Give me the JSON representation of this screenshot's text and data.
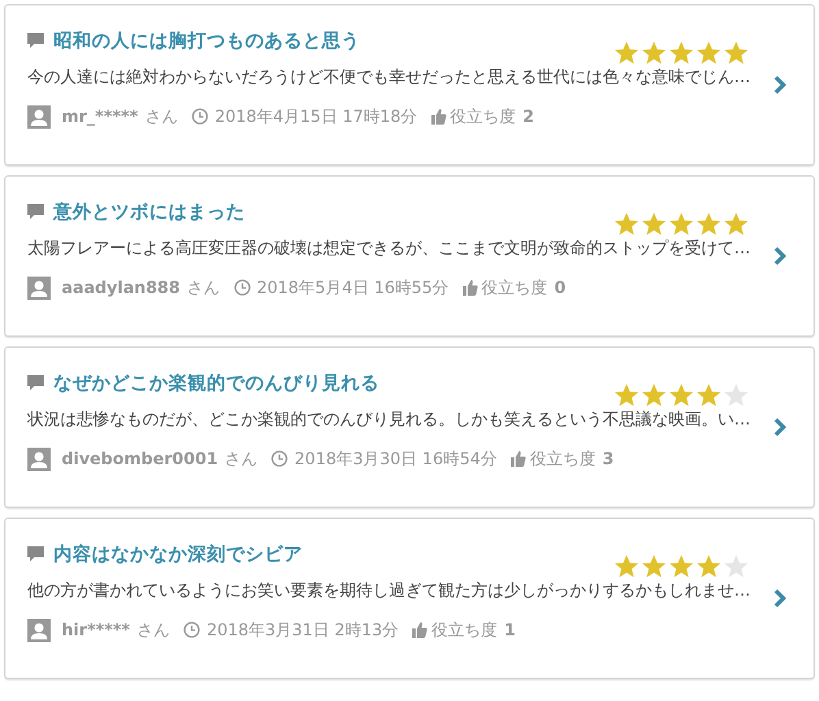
{
  "reviews": [
    {
      "title": "昭和の人には胸打つものあると思う",
      "stars": 5,
      "excerpt": "今の人達には絶対わからないだろうけど不便でも幸せだったと思える世代には色々な意味でじん…",
      "user": "mr_*****",
      "honorific": "さん",
      "date": "2018年4月15日 17時18分",
      "helpful_label": "役立ち度",
      "helpful_count": "2"
    },
    {
      "title": "意外とツボにはまった",
      "stars": 5,
      "excerpt": "太陽フレアーによる高圧変圧器の破壊は想定できるが、ここまで文明が致命的ストップを受けて…",
      "user": "aaadylan888",
      "honorific": "さん",
      "date": "2018年5月4日 16時55分",
      "helpful_label": "役立ち度",
      "helpful_count": "0"
    },
    {
      "title": "なぜかどこか楽観的でのんびり見れる",
      "stars": 4,
      "excerpt": "状況は悲惨なものだが、どこか楽観的でのんびり見れる。しかも笑えるという不思議な映画。い…",
      "user": "divebomber0001",
      "honorific": "さん",
      "date": "2018年3月30日 16時54分",
      "helpful_label": "役立ち度",
      "helpful_count": "3"
    },
    {
      "title": "内容はなかなか深刻でシビア",
      "stars": 4,
      "excerpt": "他の方が書かれているようにお笑い要素を期待し過ぎて観た方は少しがっかりするかもしれませ…",
      "user": "hir*****",
      "honorific": "さん",
      "date": "2018年3月31日 2時13分",
      "helpful_label": "役立ち度",
      "helpful_count": "1"
    }
  ]
}
